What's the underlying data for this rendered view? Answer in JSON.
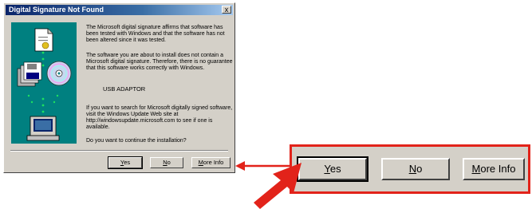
{
  "dialog": {
    "title": "Digital Signature Not Found",
    "close_label": "x",
    "paragraph1": "The Microsoft digital signature affirms that software has been tested with Windows and that the software has not been altered since it was tested.",
    "paragraph2": "The software you are about to install does not contain a Microsoft digital signature. Therefore, there is no guarantee that this software works correctly with Windows.",
    "device_name": "USB ADAPTOR",
    "paragraph3": "If you want to search for Microsoft digitally signed software, visit the Windows Update Web site at http://windowsupdate.microsoft.com to see if one is available.",
    "question": "Do you want to continue the installation?",
    "buttons": {
      "yes_mnemonic": "Y",
      "yes_rest": "es",
      "no_mnemonic": "N",
      "no_rest": "o",
      "more_mnemonic": "M",
      "more_rest": "ore Info"
    }
  },
  "colors": {
    "highlight": "#e2231a",
    "dialog_face": "#d4d0c8",
    "title_bar": "#0a246a"
  }
}
